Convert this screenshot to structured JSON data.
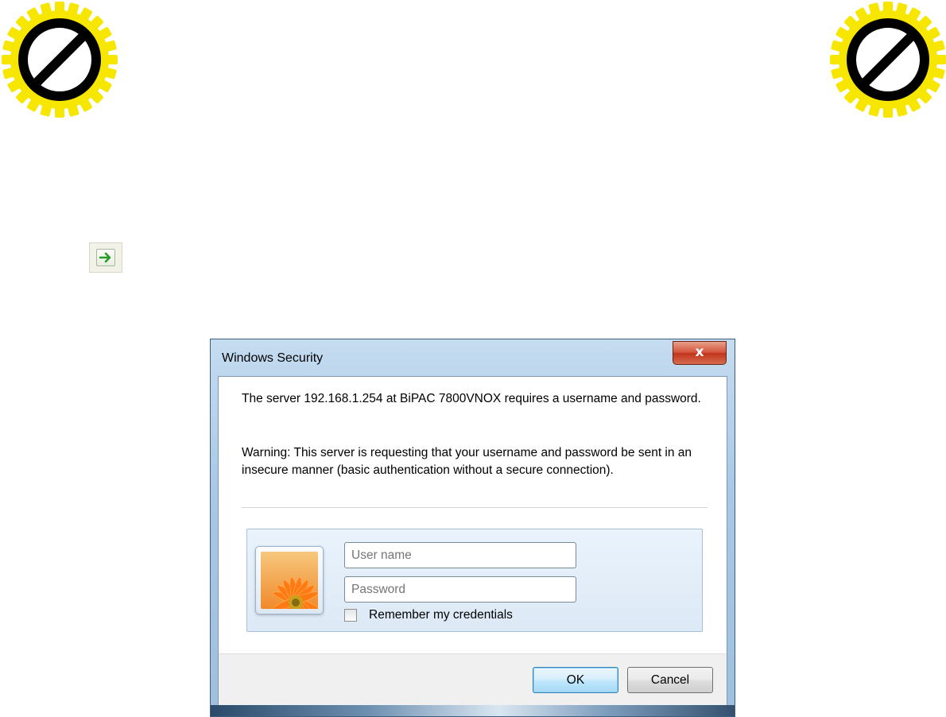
{
  "badges": {
    "icon": "no-entry-sign-icon",
    "gear_color": "#f6e600",
    "ring_color": "#000000"
  },
  "go_button": {
    "icon": "go-arrow-icon"
  },
  "dialog": {
    "title": "Windows Security",
    "close_label": "x",
    "message": "The server 192.168.1.254 at BiPAC 7800VNOX requires a username and password.",
    "warning": "Warning: This server is requesting that your username and password be sent in an insecure manner (basic authentication without a secure connection).",
    "avatar_icon": "user-picture-flower-icon",
    "username_placeholder": "User name",
    "password_placeholder": "Password",
    "remember_label": "Remember my credentials",
    "ok_label": "OK",
    "cancel_label": "Cancel"
  }
}
